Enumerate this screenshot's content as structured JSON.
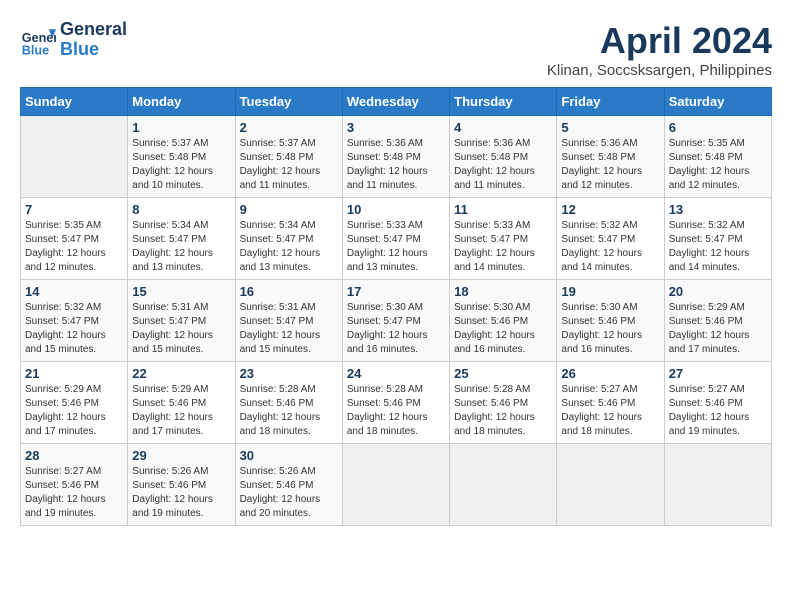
{
  "header": {
    "logo_line1": "General",
    "logo_line2": "Blue",
    "month_year": "April 2024",
    "location": "Klinan, Soccsksargen, Philippines"
  },
  "weekdays": [
    "Sunday",
    "Monday",
    "Tuesday",
    "Wednesday",
    "Thursday",
    "Friday",
    "Saturday"
  ],
  "weeks": [
    [
      {
        "day": "",
        "detail": ""
      },
      {
        "day": "1",
        "detail": "Sunrise: 5:37 AM\nSunset: 5:48 PM\nDaylight: 12 hours\nand 10 minutes."
      },
      {
        "day": "2",
        "detail": "Sunrise: 5:37 AM\nSunset: 5:48 PM\nDaylight: 12 hours\nand 11 minutes."
      },
      {
        "day": "3",
        "detail": "Sunrise: 5:36 AM\nSunset: 5:48 PM\nDaylight: 12 hours\nand 11 minutes."
      },
      {
        "day": "4",
        "detail": "Sunrise: 5:36 AM\nSunset: 5:48 PM\nDaylight: 12 hours\nand 11 minutes."
      },
      {
        "day": "5",
        "detail": "Sunrise: 5:36 AM\nSunset: 5:48 PM\nDaylight: 12 hours\nand 12 minutes."
      },
      {
        "day": "6",
        "detail": "Sunrise: 5:35 AM\nSunset: 5:48 PM\nDaylight: 12 hours\nand 12 minutes."
      }
    ],
    [
      {
        "day": "7",
        "detail": "Sunrise: 5:35 AM\nSunset: 5:47 PM\nDaylight: 12 hours\nand 12 minutes."
      },
      {
        "day": "8",
        "detail": "Sunrise: 5:34 AM\nSunset: 5:47 PM\nDaylight: 12 hours\nand 13 minutes."
      },
      {
        "day": "9",
        "detail": "Sunrise: 5:34 AM\nSunset: 5:47 PM\nDaylight: 12 hours\nand 13 minutes."
      },
      {
        "day": "10",
        "detail": "Sunrise: 5:33 AM\nSunset: 5:47 PM\nDaylight: 12 hours\nand 13 minutes."
      },
      {
        "day": "11",
        "detail": "Sunrise: 5:33 AM\nSunset: 5:47 PM\nDaylight: 12 hours\nand 14 minutes."
      },
      {
        "day": "12",
        "detail": "Sunrise: 5:32 AM\nSunset: 5:47 PM\nDaylight: 12 hours\nand 14 minutes."
      },
      {
        "day": "13",
        "detail": "Sunrise: 5:32 AM\nSunset: 5:47 PM\nDaylight: 12 hours\nand 14 minutes."
      }
    ],
    [
      {
        "day": "14",
        "detail": "Sunrise: 5:32 AM\nSunset: 5:47 PM\nDaylight: 12 hours\nand 15 minutes."
      },
      {
        "day": "15",
        "detail": "Sunrise: 5:31 AM\nSunset: 5:47 PM\nDaylight: 12 hours\nand 15 minutes."
      },
      {
        "day": "16",
        "detail": "Sunrise: 5:31 AM\nSunset: 5:47 PM\nDaylight: 12 hours\nand 15 minutes."
      },
      {
        "day": "17",
        "detail": "Sunrise: 5:30 AM\nSunset: 5:47 PM\nDaylight: 12 hours\nand 16 minutes."
      },
      {
        "day": "18",
        "detail": "Sunrise: 5:30 AM\nSunset: 5:46 PM\nDaylight: 12 hours\nand 16 minutes."
      },
      {
        "day": "19",
        "detail": "Sunrise: 5:30 AM\nSunset: 5:46 PM\nDaylight: 12 hours\nand 16 minutes."
      },
      {
        "day": "20",
        "detail": "Sunrise: 5:29 AM\nSunset: 5:46 PM\nDaylight: 12 hours\nand 17 minutes."
      }
    ],
    [
      {
        "day": "21",
        "detail": "Sunrise: 5:29 AM\nSunset: 5:46 PM\nDaylight: 12 hours\nand 17 minutes."
      },
      {
        "day": "22",
        "detail": "Sunrise: 5:29 AM\nSunset: 5:46 PM\nDaylight: 12 hours\nand 17 minutes."
      },
      {
        "day": "23",
        "detail": "Sunrise: 5:28 AM\nSunset: 5:46 PM\nDaylight: 12 hours\nand 18 minutes."
      },
      {
        "day": "24",
        "detail": "Sunrise: 5:28 AM\nSunset: 5:46 PM\nDaylight: 12 hours\nand 18 minutes."
      },
      {
        "day": "25",
        "detail": "Sunrise: 5:28 AM\nSunset: 5:46 PM\nDaylight: 12 hours\nand 18 minutes."
      },
      {
        "day": "26",
        "detail": "Sunrise: 5:27 AM\nSunset: 5:46 PM\nDaylight: 12 hours\nand 18 minutes."
      },
      {
        "day": "27",
        "detail": "Sunrise: 5:27 AM\nSunset: 5:46 PM\nDaylight: 12 hours\nand 19 minutes."
      }
    ],
    [
      {
        "day": "28",
        "detail": "Sunrise: 5:27 AM\nSunset: 5:46 PM\nDaylight: 12 hours\nand 19 minutes."
      },
      {
        "day": "29",
        "detail": "Sunrise: 5:26 AM\nSunset: 5:46 PM\nDaylight: 12 hours\nand 19 minutes."
      },
      {
        "day": "30",
        "detail": "Sunrise: 5:26 AM\nSunset: 5:46 PM\nDaylight: 12 hours\nand 20 minutes."
      },
      {
        "day": "",
        "detail": ""
      },
      {
        "day": "",
        "detail": ""
      },
      {
        "day": "",
        "detail": ""
      },
      {
        "day": "",
        "detail": ""
      }
    ]
  ]
}
